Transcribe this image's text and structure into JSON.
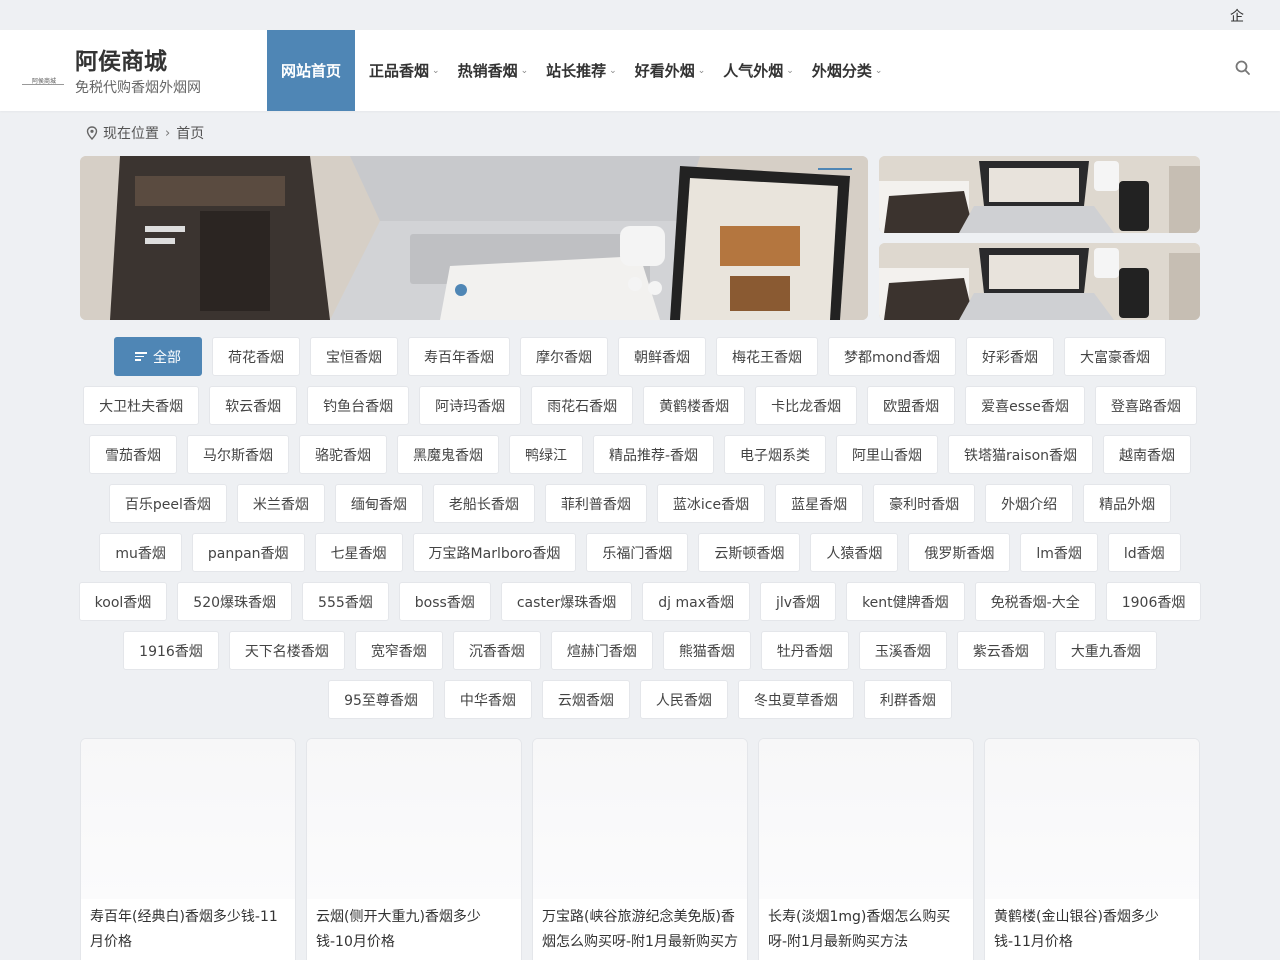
{
  "topbar": {
    "corner_label": "企"
  },
  "header": {
    "logo_small": "阿侯商城",
    "title": "阿侯商城",
    "subtitle": "免税代购香烟外烟网"
  },
  "nav": {
    "items": [
      {
        "label": "网站首页",
        "active": true,
        "dropdown": false
      },
      {
        "label": "正品香烟",
        "dropdown": true
      },
      {
        "label": "热销香烟",
        "dropdown": true
      },
      {
        "label": "站长推荐",
        "dropdown": true
      },
      {
        "label": "好看外烟",
        "dropdown": true
      },
      {
        "label": "人气外烟",
        "dropdown": true
      },
      {
        "label": "外烟分类",
        "dropdown": true
      }
    ],
    "search_icon": "search-icon"
  },
  "breadcrumb": {
    "icon": "location-pin-icon",
    "label": "现在位置",
    "current": "首页"
  },
  "tags": {
    "rows": [
      [
        "全部",
        "荷花香烟",
        "宝恒香烟",
        "寿百年香烟",
        "摩尔香烟",
        "朝鲜香烟",
        "梅花王香烟",
        "梦都mond香烟",
        "好彩香烟",
        "大富豪香烟"
      ],
      [
        "大卫杜夫香烟",
        "软云香烟",
        "钓鱼台香烟",
        "阿诗玛香烟",
        "雨花石香烟",
        "黄鹤楼香烟",
        "卡比龙香烟",
        "欧盟香烟",
        "爱喜esse香烟",
        "登喜路香烟"
      ],
      [
        "雪茄香烟",
        "马尔斯香烟",
        "骆驼香烟",
        "黑魔鬼香烟",
        "鸭绿江",
        "精品推荐-香烟",
        "电子烟系类",
        "阿里山香烟",
        "铁塔猫raison香烟",
        "越南香烟"
      ],
      [
        "百乐peel香烟",
        "米兰香烟",
        "缅甸香烟",
        "老船长香烟",
        "菲利普香烟",
        "蓝冰ice香烟",
        "蓝星香烟",
        "豪利时香烟",
        "外烟介绍",
        "精品外烟"
      ],
      [
        "mu香烟",
        "panpan香烟",
        "七星香烟",
        "万宝路Marlboro香烟",
        "乐福门香烟",
        "云斯顿香烟",
        "人猿香烟",
        "俄罗斯香烟",
        "lm香烟",
        "ld香烟"
      ],
      [
        "kool香烟",
        "520爆珠香烟",
        "555香烟",
        "boss香烟",
        "caster爆珠香烟",
        "dj max香烟",
        "jlv香烟",
        "kent健牌香烟",
        "免税香烟-大全",
        "1906香烟"
      ],
      [
        "1916香烟",
        "天下名楼香烟",
        "宽窄香烟",
        "沉香香烟",
        "煊赫门香烟",
        "熊猫香烟",
        "牡丹香烟",
        "玉溪香烟",
        "紫云香烟",
        "大重九香烟"
      ],
      [
        "95至尊香烟",
        "中华香烟",
        "云烟香烟",
        "人民香烟",
        "冬虫夏草香烟",
        "利群香烟"
      ]
    ]
  },
  "cards": [
    {
      "title": "寿百年(经典白)香烟多少钱-11月价格"
    },
    {
      "title": "云烟(侧开大重九)香烟多少钱-10月价格"
    },
    {
      "title": "万宝路(峡谷旅游纪念美免版)香烟怎么购买呀-附1月最新购买方"
    },
    {
      "title": "长寿(淡烟1mg)香烟怎么购买呀-附1月最新购买方法"
    },
    {
      "title": "黄鹤楼(金山银谷)香烟多少钱-11月价格"
    }
  ],
  "colors": {
    "accent": "#4f86b5",
    "background": "#eef0f3"
  }
}
